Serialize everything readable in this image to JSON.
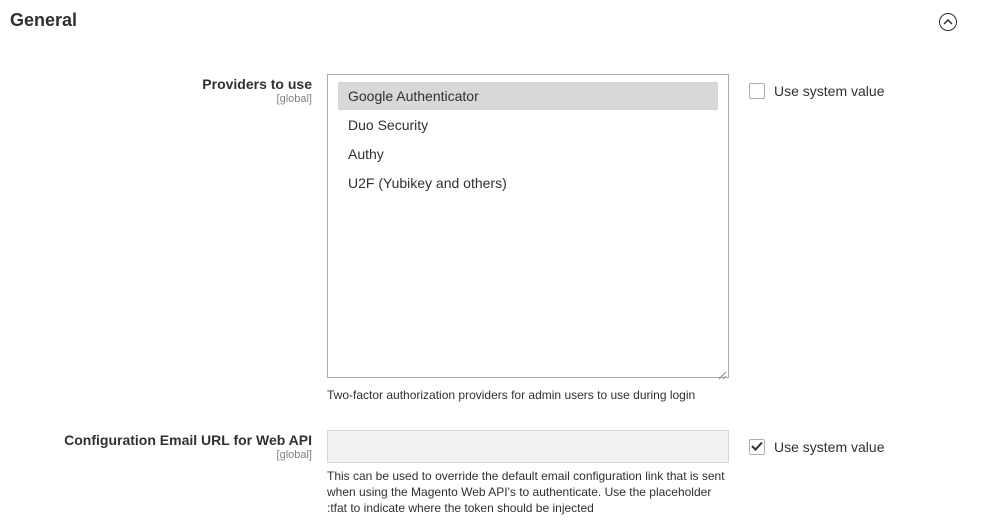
{
  "section": {
    "title": "General"
  },
  "providers_field": {
    "label": "Providers to use",
    "scope": "[global]",
    "options": [
      {
        "label": "Google Authenticator",
        "selected": true
      },
      {
        "label": "Duo Security",
        "selected": false
      },
      {
        "label": "Authy",
        "selected": false
      },
      {
        "label": "U2F (Yubikey and others)",
        "selected": false
      }
    ],
    "use_system_value_label": "Use system value",
    "use_system_value_checked": false,
    "note": "Two-factor authorization providers for admin users to use during login"
  },
  "webapi_field": {
    "label": "Configuration Email URL for Web API",
    "scope": "[global]",
    "value": "",
    "use_system_value_label": "Use system value",
    "use_system_value_checked": true,
    "note": "This can be used to override the default email configuration link that is sent when using the Magento Web API's to authenticate. Use the placeholder :tfat to indicate where the token should be injected"
  },
  "icons": {
    "collapse": "chevron-up-circle-icon",
    "checkmark": "checkmark-icon",
    "resize": "resize-grip-icon"
  }
}
